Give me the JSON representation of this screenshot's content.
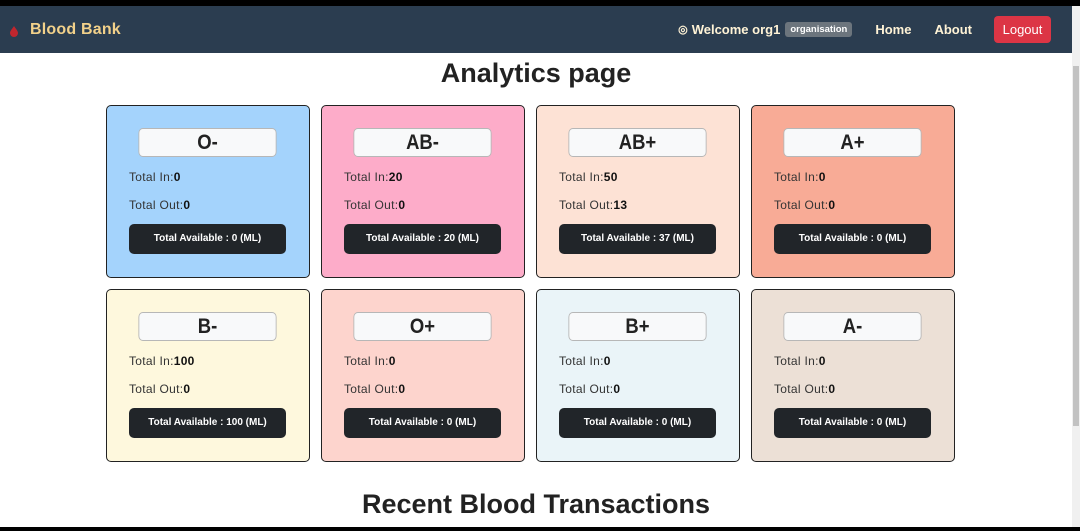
{
  "navbar": {
    "brand": "Blood Bank",
    "welcome": "Welcome org1",
    "role_badge": "organisation",
    "links": [
      "Home",
      "About"
    ],
    "logout": "Logout",
    "brand_color": "#f2d18a",
    "bg_color": "#2b3d50"
  },
  "page_title": "Analytics page",
  "section_title": "Recent Blood Transactions",
  "labels": {
    "total_in": "Total In:",
    "total_out": "Total Out:"
  },
  "cards": [
    {
      "group": "O-",
      "total_in": "0",
      "total_out": "0",
      "available": "Total Available : 0 (ML)",
      "color": "#a4d3fc"
    },
    {
      "group": "AB-",
      "total_in": "20",
      "total_out": "0",
      "available": "Total Available : 20 (ML)",
      "color": "#fdacc9"
    },
    {
      "group": "AB+",
      "total_in": "50",
      "total_out": "13",
      "available": "Total Available : 37 (ML)",
      "color": "#fde2d5"
    },
    {
      "group": "A+",
      "total_in": "0",
      "total_out": "0",
      "available": "Total Available : 0 (ML)",
      "color": "#f8ab96"
    },
    {
      "group": "B-",
      "total_in": "100",
      "total_out": "0",
      "available": "Total Available : 100 (ML)",
      "color": "#fef8dd"
    },
    {
      "group": "O+",
      "total_in": "0",
      "total_out": "0",
      "available": "Total Available : 0 (ML)",
      "color": "#fdd4cd"
    },
    {
      "group": "B+",
      "total_in": "0",
      "total_out": "0",
      "available": "Total Available : 0 (ML)",
      "color": "#eaf4f8"
    },
    {
      "group": "A-",
      "total_in": "0",
      "total_out": "0",
      "available": "Total Available : 0 (ML)",
      "color": "#ece0d6"
    }
  ]
}
